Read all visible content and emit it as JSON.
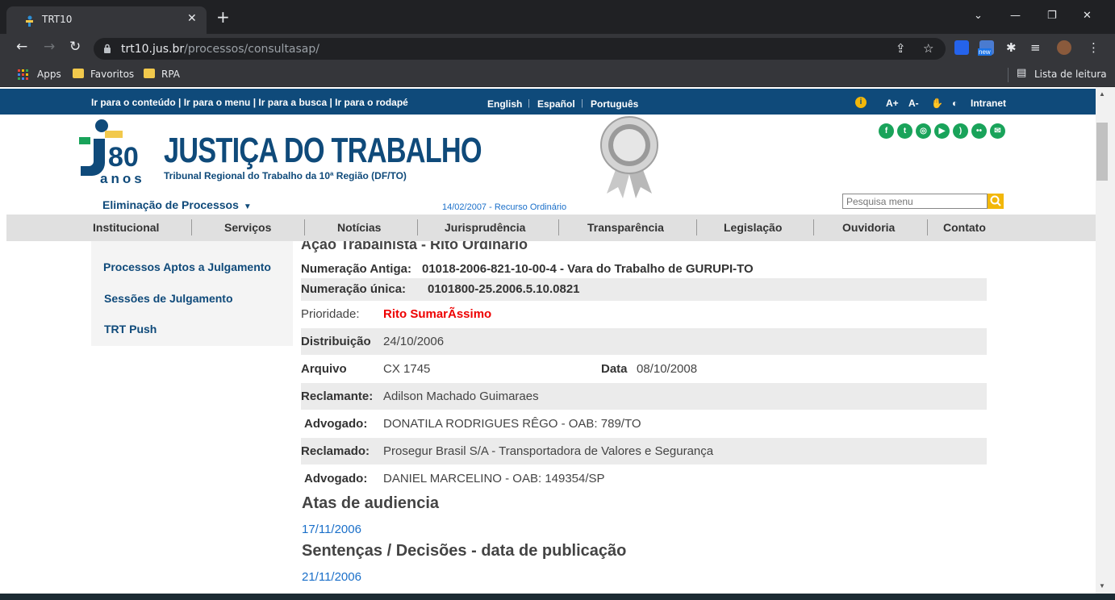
{
  "browser": {
    "tab_title": "TRT10",
    "tab_close": "✕",
    "new_tab": "+",
    "url_host": "trt10.jus.br",
    "url_path": "/processos/consultasap/",
    "bookmarks": [
      "Apps",
      "Favoritos",
      "RPA"
    ],
    "reading_list": "Lista de leitura",
    "ext_badge": "new"
  },
  "accessibility": {
    "links": "Ir para o conteúdo | Ir para o menu | Ir para a busca | Ir para o rodapé",
    "languages": [
      "English",
      "Español",
      "Português"
    ],
    "font_increase": "A+",
    "font_decrease": "A-",
    "intranet": "Intranet"
  },
  "header": {
    "logo_number": "80",
    "logo_anos": "anos",
    "title": "JUSTIÇA DO TRABALHO",
    "subtitle": "Tribunal Regional do Trabalho da 10ª Região (DF/TO)",
    "social_icons": [
      "facebook-icon",
      "twitter-icon",
      "instagram-icon",
      "youtube-icon",
      "rss-icon",
      "flickr-icon",
      "email-icon"
    ]
  },
  "subheader": {
    "elimination": "Eliminação de Processos",
    "breadcrumb_date": "14/02/2007 - Recurso Ordinário",
    "search_placeholder": "Pesquisa menu"
  },
  "nav": [
    "Institucional",
    "Serviços",
    "Notícias",
    "Jurisprudência",
    "Transparência",
    "Legislação",
    "Ouvidoria",
    "Contato"
  ],
  "sidebar": [
    "Processos Aptos a Julgamento",
    "Sessões de Julgamento",
    "TRT Push"
  ],
  "process": {
    "title": "Ação Trabalhista - Rito Ordinário",
    "numeracao_antiga_label": "Numeração Antiga:",
    "numeracao_antiga": "01018-2006-821-10-00-4 - Vara do Trabalho de GURUPI-TO",
    "numeracao_unica_label": "Numeração única:",
    "numeracao_unica": "0101800-25.2006.5.10.0821",
    "prioridade_label": "Prioridade:",
    "prioridade": "Rito SumarÃssimo",
    "distribuicao_label": "Distribuição",
    "distribuicao": "24/10/2006",
    "arquivo_label": "Arquivo",
    "arquivo": "CX 1745",
    "data_label": "Data",
    "data": "08/10/2008",
    "reclamante_label": "Reclamante:",
    "reclamante": "Adilson Machado Guimaraes",
    "advogado1_label": "Advogado:",
    "advogado1": "DONATILA RODRIGUES RÊGO - OAB: 789/TO",
    "reclamado_label": "Reclamado:",
    "reclamado": "Prosegur Brasil S/A - Transportadora de Valores e Segurança",
    "advogado2_label": "Advogado:",
    "advogado2": "DANIEL MARCELINO - OAB: 149354/SP"
  },
  "atas": {
    "heading": "Atas de audiencia",
    "dates": [
      "17/11/2006"
    ]
  },
  "sentencas": {
    "heading": "Sentenças / Decisões - data de publicação",
    "dates": [
      "21/11/2006"
    ]
  }
}
